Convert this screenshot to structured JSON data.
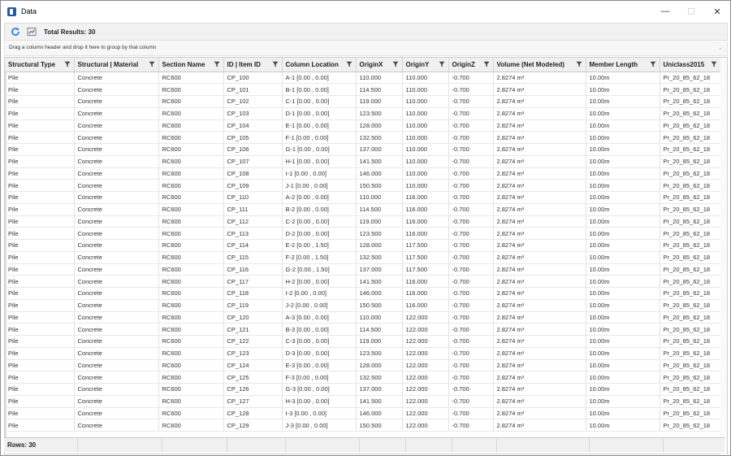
{
  "window": {
    "title": "Data",
    "minimize": "—",
    "maximize": "☐",
    "close": "✕"
  },
  "toolbar": {
    "refresh_icon": "refresh-icon",
    "export_icon": "chart-export-icon",
    "total_results": "Total Results: 30"
  },
  "group_panel": {
    "hint": "Drag a column header and drop it here to group by that column"
  },
  "columns": [
    "Structural Type",
    "Structural | Material",
    "Section Name",
    "ID | Item ID",
    "Column Location",
    "OriginX",
    "OriginY",
    "OriginZ",
    "Volume (Net Modeled)",
    "Member Length",
    "Uniclass2015"
  ],
  "rows": [
    [
      "Pile",
      "Concrete",
      "RC600",
      "CP_100",
      "A-1 [0.00 , 0.00]",
      "110.000",
      "110.000",
      "-0.700",
      "2.8274 m³",
      "10.00m",
      "Pr_20_85_62_18"
    ],
    [
      "Pile",
      "Concrete",
      "RC600",
      "CP_101",
      "B-1 [0.00 , 0.00]",
      "114.500",
      "110.000",
      "-0.700",
      "2.8274 m³",
      "10.00m",
      "Pr_20_85_62_18"
    ],
    [
      "Pile",
      "Concrete",
      "RC600",
      "CP_102",
      "C-1 [0.00 , 0.00]",
      "119.000",
      "110.000",
      "-0.700",
      "2.8274 m³",
      "10.00m",
      "Pr_20_85_62_18"
    ],
    [
      "Pile",
      "Concrete",
      "RC600",
      "CP_103",
      "D-1 [0.00 , 0.00]",
      "123.500",
      "110.000",
      "-0.700",
      "2.8274 m³",
      "10.00m",
      "Pr_20_85_62_18"
    ],
    [
      "Pile",
      "Concrete",
      "RC600",
      "CP_104",
      "E-1 [0.00 , 0.00]",
      "128.000",
      "110.000",
      "-0.700",
      "2.8274 m³",
      "10.00m",
      "Pr_20_85_62_18"
    ],
    [
      "Pile",
      "Concrete",
      "RC600",
      "CP_105",
      "F-1 [0.00 , 0.00]",
      "132.500",
      "110.000",
      "-0.700",
      "2.8274 m³",
      "10.00m",
      "Pr_20_85_62_18"
    ],
    [
      "Pile",
      "Concrete",
      "RC600",
      "CP_106",
      "G-1 [0.00 , 0.00]",
      "137.000",
      "110.000",
      "-0.700",
      "2.8274 m³",
      "10.00m",
      "Pr_20_85_62_18"
    ],
    [
      "Pile",
      "Concrete",
      "RC600",
      "CP_107",
      "H-1 [0.00 , 0.00]",
      "141.500",
      "110.000",
      "-0.700",
      "2.8274 m³",
      "10.00m",
      "Pr_20_85_62_18"
    ],
    [
      "Pile",
      "Concrete",
      "RC600",
      "CP_108",
      "I-1 [0.00 , 0.00]",
      "146.000",
      "110.000",
      "-0.700",
      "2.8274 m³",
      "10.00m",
      "Pr_20_85_62_18"
    ],
    [
      "Pile",
      "Concrete",
      "RC600",
      "CP_109",
      "J-1 [0.00 , 0.00]",
      "150.500",
      "110.000",
      "-0.700",
      "2.8274 m³",
      "10.00m",
      "Pr_20_85_62_18"
    ],
    [
      "Pile",
      "Concrete",
      "RC600",
      "CP_110",
      "A-2 [0.00 , 0.00]",
      "110.000",
      "116.000",
      "-0.700",
      "2.8274 m³",
      "10.00m",
      "Pr_20_85_62_18"
    ],
    [
      "Pile",
      "Concrete",
      "RC600",
      "CP_111",
      "B-2 [0.00 , 0.00]",
      "114.500",
      "116.000",
      "-0.700",
      "2.8274 m³",
      "10.00m",
      "Pr_20_85_62_18"
    ],
    [
      "Pile",
      "Concrete",
      "RC600",
      "CP_112",
      "C-2 [0.00 , 0.00]",
      "119.000",
      "116.000",
      "-0.700",
      "2.8274 m³",
      "10.00m",
      "Pr_20_85_62_18"
    ],
    [
      "Pile",
      "Concrete",
      "RC600",
      "CP_113",
      "D-2 [0.00 , 0.00]",
      "123.500",
      "116.000",
      "-0.700",
      "2.8274 m³",
      "10.00m",
      "Pr_20_85_62_18"
    ],
    [
      "Pile",
      "Concrete",
      "RC600",
      "CP_114",
      "E-2 [0.00 , 1.50]",
      "128.000",
      "117.500",
      "-0.700",
      "2.8274 m³",
      "10.00m",
      "Pr_20_85_62_18"
    ],
    [
      "Pile",
      "Concrete",
      "RC600",
      "CP_115",
      "F-2 [0.00 , 1.50]",
      "132.500",
      "117.500",
      "-0.700",
      "2.8274 m³",
      "10.00m",
      "Pr_20_85_62_18"
    ],
    [
      "Pile",
      "Concrete",
      "RC600",
      "CP_116",
      "G-2 [0.00 , 1.50]",
      "137.000",
      "117.500",
      "-0.700",
      "2.8274 m³",
      "10.00m",
      "Pr_20_85_62_18"
    ],
    [
      "Pile",
      "Concrete",
      "RC600",
      "CP_117",
      "H-2 [0.00 , 0.00]",
      "141.500",
      "116.000",
      "-0.700",
      "2.8274 m³",
      "10.00m",
      "Pr_20_85_62_18"
    ],
    [
      "Pile",
      "Concrete",
      "RC600",
      "CP_118",
      "I-2 [0.00 , 0.00]",
      "146.000",
      "116.000",
      "-0.700",
      "2.8274 m³",
      "10.00m",
      "Pr_20_85_62_18"
    ],
    [
      "Pile",
      "Concrete",
      "RC600",
      "CP_119",
      "J-2 [0.00 , 0.00]",
      "150.500",
      "116.000",
      "-0.700",
      "2.8274 m³",
      "10.00m",
      "Pr_20_85_62_18"
    ],
    [
      "Pile",
      "Concrete",
      "RC600",
      "CP_120",
      "A-3 [0.00 , 0.00]",
      "110.000",
      "122.000",
      "-0.700",
      "2.8274 m³",
      "10.00m",
      "Pr_20_85_62_18"
    ],
    [
      "Pile",
      "Concrete",
      "RC600",
      "CP_121",
      "B-3 [0.00 , 0.00]",
      "114.500",
      "122.000",
      "-0.700",
      "2.8274 m³",
      "10.00m",
      "Pr_20_85_62_18"
    ],
    [
      "Pile",
      "Concrete",
      "RC600",
      "CP_122",
      "C-3 [0.00 , 0.00]",
      "119.000",
      "122.000",
      "-0.700",
      "2.8274 m³",
      "10.00m",
      "Pr_20_85_62_18"
    ],
    [
      "Pile",
      "Concrete",
      "RC600",
      "CP_123",
      "D-3 [0.00 , 0.00]",
      "123.500",
      "122.000",
      "-0.700",
      "2.8274 m³",
      "10.00m",
      "Pr_20_85_62_18"
    ],
    [
      "Pile",
      "Concrete",
      "RC600",
      "CP_124",
      "E-3 [0.00 , 0.00]",
      "128.000",
      "122.000",
      "-0.700",
      "2.8274 m³",
      "10.00m",
      "Pr_20_85_62_18"
    ],
    [
      "Pile",
      "Concrete",
      "RC600",
      "CP_125",
      "F-3 [0.00 , 0.00]",
      "132.500",
      "122.000",
      "-0.700",
      "2.8274 m³",
      "10.00m",
      "Pr_20_85_62_18"
    ],
    [
      "Pile",
      "Concrete",
      "RC600",
      "CP_126",
      "G-3 [0.00 , 0.00]",
      "137.000",
      "122.000",
      "-0.700",
      "2.8274 m³",
      "10.00m",
      "Pr_20_85_62_18"
    ],
    [
      "Pile",
      "Concrete",
      "RC600",
      "CP_127",
      "H-3 [0.00 , 0.00]",
      "141.500",
      "122.000",
      "-0.700",
      "2.8274 m³",
      "10.00m",
      "Pr_20_85_62_18"
    ],
    [
      "Pile",
      "Concrete",
      "RC600",
      "CP_128",
      "I-3 [0.00 , 0.00]",
      "146.000",
      "122.000",
      "-0.700",
      "2.8274 m³",
      "10.00m",
      "Pr_20_85_62_18"
    ],
    [
      "Pile",
      "Concrete",
      "RC600",
      "CP_129",
      "J-3 [0.00 , 0.00]",
      "150.500",
      "122.000",
      "-0.700",
      "2.8274 m³",
      "10.00m",
      "Pr_20_85_62_18"
    ]
  ],
  "footer": {
    "rows_label": "Rows: 30"
  },
  "colors": {
    "accent": "#1e5aa8",
    "refresh": "#2b7fd4",
    "header_bg": "#f0f0f0"
  }
}
